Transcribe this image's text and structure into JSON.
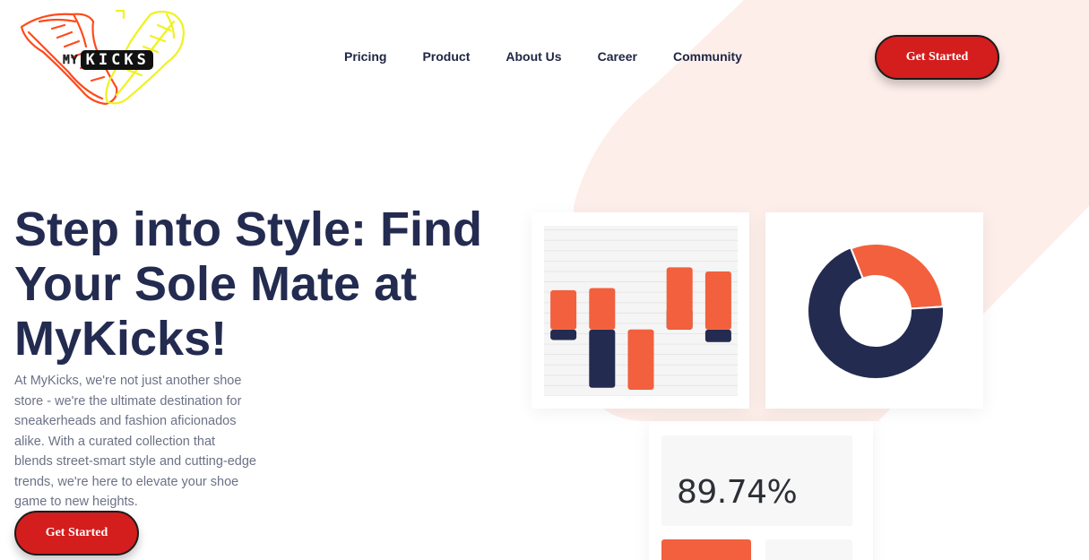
{
  "brand": {
    "logo_my": "MY",
    "logo_kicks": "KICKS",
    "colors": {
      "navy": "#232b50",
      "orange": "#f2603d",
      "red": "#d41d1d",
      "peach": "#fdeeea",
      "logo_left_shoe": "#ff4a1c",
      "logo_right_shoe": "#f0f21e"
    }
  },
  "nav": {
    "items": [
      {
        "label": "Pricing"
      },
      {
        "label": "Product"
      },
      {
        "label": "About Us"
      },
      {
        "label": "Career"
      },
      {
        "label": "Community"
      }
    ]
  },
  "header": {
    "cta_label": "Get Started"
  },
  "hero": {
    "title": "Step into Style: Find Your Sole Mate at MyKicks!",
    "description": "At MyKicks, we're not just another shoe store - we're the ultimate destination for sneakerheads and fashion aficionados alike. With a curated collection that blends street-smart style and cutting-edge trends, we're here to elevate your shoe game to new heights.",
    "cta_label": "Get Started"
  },
  "chart_data": [
    {
      "type": "bar",
      "note_series": "each column shows an orange segment and a navy segment around a shared baseline",
      "series": [
        {
          "color": "#f2603d",
          "values": [
            1.9,
            2.0,
            -2.9,
            3.0,
            2.8
          ]
        },
        {
          "color": "#232b50",
          "values": [
            -0.5,
            -2.8,
            -1.9,
            1.0,
            -0.6
          ]
        }
      ],
      "ylim": [
        -3.2,
        5.0
      ],
      "grid": true
    },
    {
      "type": "pie",
      "style": "donut",
      "values": [
        30,
        70
      ],
      "colors": [
        "#f2603d",
        "#232b50"
      ]
    }
  ],
  "stats": {
    "value": "89.74%"
  }
}
